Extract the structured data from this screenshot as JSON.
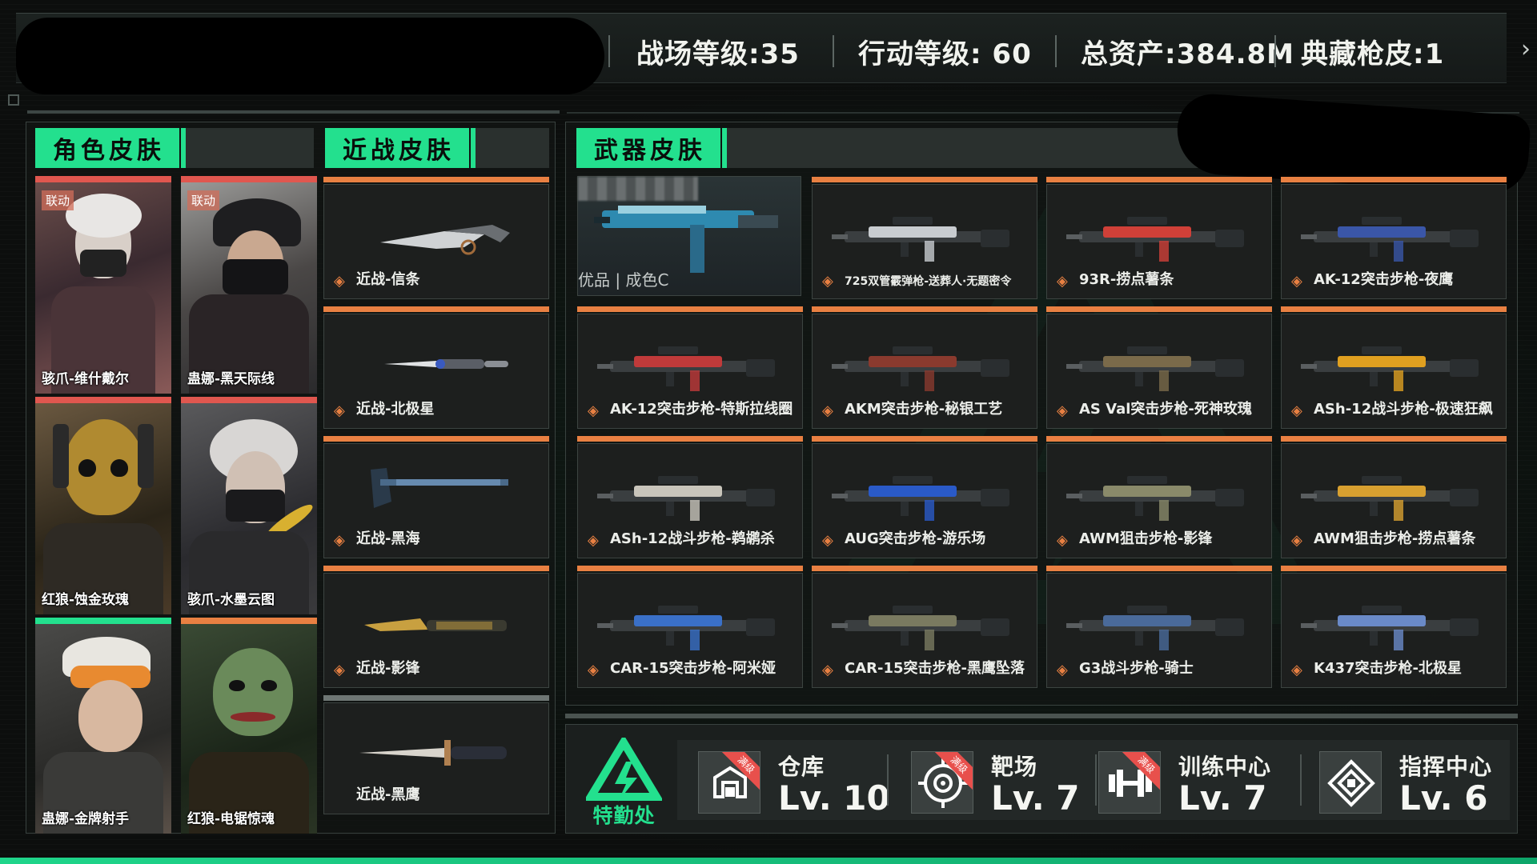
{
  "header": {
    "stats": [
      "战场等级:35",
      "行动等级: 60",
      "总资产:384.8M",
      "典藏枪皮:1"
    ],
    "next_icon": "chevron-right-icon"
  },
  "sections": {
    "character": "角色皮肤",
    "melee": "近战皮肤",
    "weapon": "武器皮肤"
  },
  "characters": [
    {
      "label": "骇爪-维什戴尔",
      "badge": "联动",
      "bar": "#e0574f"
    },
    {
      "label": "蛊娜-黑天际线",
      "badge": "联动",
      "bar": "#e0574f"
    },
    {
      "label": "红狼-蚀金玫瑰",
      "badge": "",
      "bar": "#e0574f"
    },
    {
      "label": "骇爪-水墨云图",
      "badge": "",
      "bar": "#e0574f"
    },
    {
      "label": "蛊娜-金牌射手",
      "badge": "",
      "bar": "#23e08e"
    },
    {
      "label": "红狼-电锯惊魂",
      "badge": "",
      "bar": "#e88042"
    }
  ],
  "melee": [
    {
      "label": "近战-信条",
      "icon": "knife-icon"
    },
    {
      "label": "近战-北极星",
      "icon": "knife-icon"
    },
    {
      "label": "近战-黑海",
      "icon": "axe-icon"
    },
    {
      "label": "近战-影锋",
      "icon": "knife-icon"
    },
    {
      "label": "近战-黑鹰",
      "icon": "dagger-icon"
    }
  ],
  "featured_weapon": {
    "grade": "优品 | 成色C"
  },
  "weapons": [
    {
      "label": "725双管霰弹枪-送葬人·无题密令",
      "color": "#c8ccd0"
    },
    {
      "label": "93R-捞点薯条",
      "color": "#d04038"
    },
    {
      "label": "AK-12突击步枪-夜鹰",
      "color": "#3a56a8"
    },
    {
      "label": "AK-12突击步枪-特斯拉线圈",
      "color": "#c03a3a"
    },
    {
      "label": "AKM突击步枪-秘银工艺",
      "color": "#8a3a2e"
    },
    {
      "label": "AS Val突击步枪-死神玫瑰",
      "color": "#7a6a4a"
    },
    {
      "label": "ASh-12战斗步枪-极速狂飙",
      "color": "#e0a020"
    },
    {
      "label": "ASh-12战斗步枪-鹈鹕杀",
      "color": "#c9c5bb"
    },
    {
      "label": "AUG突击步枪-游乐场",
      "color": "#2a5ac8"
    },
    {
      "label": "AWM狙击步枪-影锋",
      "color": "#8a8a6a"
    },
    {
      "label": "AWM狙击步枪-捞点薯条",
      "color": "#d8a030"
    },
    {
      "label": "CAR-15突击步枪-阿米娅",
      "color": "#3a70c8"
    },
    {
      "label": "CAR-15突击步枪-黑鹰坠落",
      "color": "#7a7a60"
    },
    {
      "label": "G3战斗步枪-骑士",
      "color": "#4a6a9a"
    },
    {
      "label": "K437突击步枪-北极星",
      "color": "#6a8ac8"
    }
  ],
  "bottom": {
    "brand": "特勤处",
    "facilities": [
      {
        "name": "仓库",
        "level": "Lv. 10",
        "ribbon": "满级",
        "icon": "warehouse-icon"
      },
      {
        "name": "靶场",
        "level": "Lv. 7",
        "ribbon": "满级",
        "icon": "target-icon"
      },
      {
        "name": "训练中心",
        "level": "Lv. 7",
        "ribbon": "满级",
        "icon": "dumbbell-icon"
      },
      {
        "name": "指挥中心",
        "level": "Lv. 6",
        "ribbon": "",
        "icon": "command-icon"
      }
    ]
  }
}
